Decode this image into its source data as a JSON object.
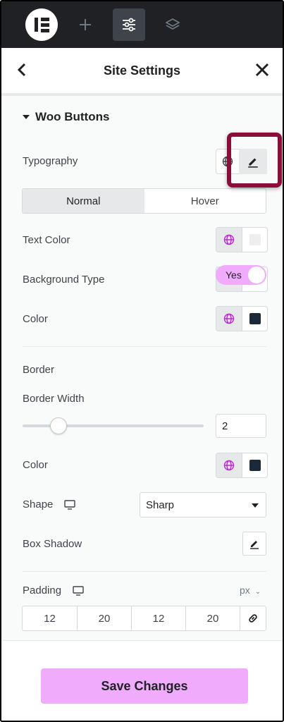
{
  "header": {
    "title": "Site Settings"
  },
  "section": {
    "title": "Woo Buttons"
  },
  "typography": {
    "label": "Typography"
  },
  "tabs": [
    {
      "label": "Normal",
      "active": true
    },
    {
      "label": "Hover",
      "active": false
    }
  ],
  "text_color": {
    "label": "Text Color",
    "value_color": "#eeeeee"
  },
  "background_type": {
    "label": "Background Type"
  },
  "color": {
    "label": "Color",
    "value_color": "#1b2a38"
  },
  "border": {
    "label": "Border",
    "toggle_label": "Yes",
    "toggle_on": true
  },
  "border_width": {
    "label": "Border Width",
    "value": "2",
    "slider_fraction": 0.2
  },
  "border_color": {
    "label": "Color",
    "value_color": "#1b2a38"
  },
  "shape": {
    "label": "Shape",
    "value": "Sharp"
  },
  "box_shadow": {
    "label": "Box Shadow"
  },
  "padding": {
    "label": "Padding",
    "unit": "px",
    "values": [
      "12",
      "20",
      "12",
      "20"
    ]
  },
  "footer": {
    "save_label": "Save Changes"
  },
  "colors": {
    "accent": "#f0abfc",
    "highlight": "#8b0e3a",
    "topbar": "#1f2124",
    "global_icon": "#c026d3"
  }
}
